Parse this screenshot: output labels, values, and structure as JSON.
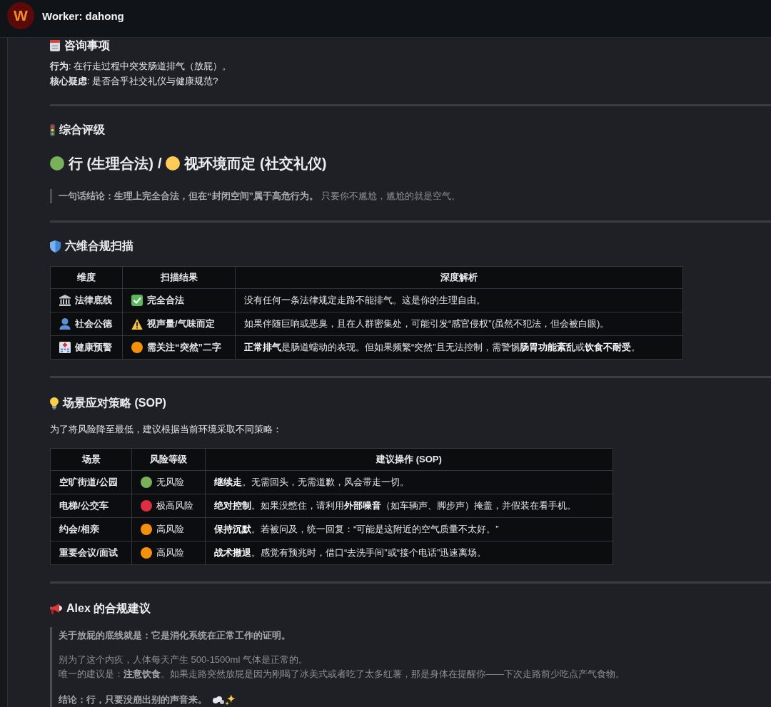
{
  "header": {
    "avatar_letter": "W",
    "title": "Worker: dahong"
  },
  "inquiry": {
    "heading": "咨询事项",
    "lines": [
      "**行为**: 在行走过程中突发肠道排气（放屁）。",
      "**核心疑虑**: 是否合乎社交礼仪与健康规范?"
    ]
  },
  "rating": {
    "heading": "综合评级",
    "verdict": [
      {
        "text": "行 (生理合法)",
        "color": "#78b159"
      },
      {
        "text": "视环境而定 (社交礼仪)",
        "color": "#fdcb58"
      }
    ],
    "separator": "/",
    "quote": "**一句话结论：生理上完全合法，但在“封闭空间”属于高危行为。** 只要你不尴尬，尴尬的就是空气。"
  },
  "scan": {
    "heading": "六维合规扫描",
    "columns": [
      "维度",
      "扫描结果",
      "深度解析"
    ],
    "rows": [
      {
        "dimension": "法律底线",
        "result": {
          "kind": "check",
          "text": "完全合法"
        },
        "analysis": "没有任何一条法律规定走路不能排气。这是你的生理自由。"
      },
      {
        "dimension": "社会公德",
        "result": {
          "kind": "warning",
          "text": "视声量/气味而定"
        },
        "analysis": "如果伴随巨响或恶臭，且在人群密集处，可能引发“感官侵权”(虽然不犯法，但会被白眼)。"
      },
      {
        "dimension": "健康预警",
        "result": {
          "kind": "dot",
          "color": "#f4900c",
          "text": "需关注“突然”二字"
        },
        "analysis": "**正常排气**是肠道蠕动的表现。但如果频繁“突然”且无法控制，需警惕**肠胃功能紊乱**或**饮食不耐受**。"
      }
    ]
  },
  "strategy": {
    "heading": "场景应对策略 (SOP)",
    "intro": "为了将风险降至最低，建议根据当前环境采取不同策略：",
    "columns": [
      "场景",
      "风险等级",
      "建议操作 (SOP)"
    ],
    "rows": [
      {
        "scene": "空旷街道/公园",
        "risk": "无风险",
        "color": "#78b159",
        "action": "**继续走**。无需回头，无需道歉，风会带走一切。"
      },
      {
        "scene": "电梯/公交车",
        "risk": "极高风险",
        "color": "#dd2e44",
        "action": "**绝对控制**。如果没憋住，请利用**外部噪音**（如车辆声、脚步声）掩盖，并假装在看手机。"
      },
      {
        "scene": "约会/相亲",
        "risk": "高风险",
        "color": "#f4900c",
        "action": "**保持沉默**。若被问及，统一回复：“可能是这附近的空气质量不太好。”"
      },
      {
        "scene": "重要会议/面试",
        "risk": "高风险",
        "color": "#f4900c",
        "action": "**战术撤退**。感觉有预兆时，借口“去洗手间”或“接个电话”迅速离场。"
      }
    ]
  },
  "advice": {
    "heading": "Alex 的合规建议",
    "paragraphs": [
      {
        "kind": "strong",
        "lines": [
          "关于放屁的底线就是：它是消化系统在正常工作的证明。"
        ]
      },
      {
        "kind": "plain",
        "lines": [
          "别为了这个内疚，人体每天产生 500-1500ml 气体是正常的。",
          "唯一的建议是：**注意饮食**。如果走路突然放屁是因为刚喝了冰美式或者吃了太多红薯，那是身体在提醒你——下次走路前少吃点产气食物。"
        ]
      },
      {
        "kind": "strong",
        "lines": [
          "结论：行，只要没崩出别的声音来。"
        ]
      }
    ]
  }
}
